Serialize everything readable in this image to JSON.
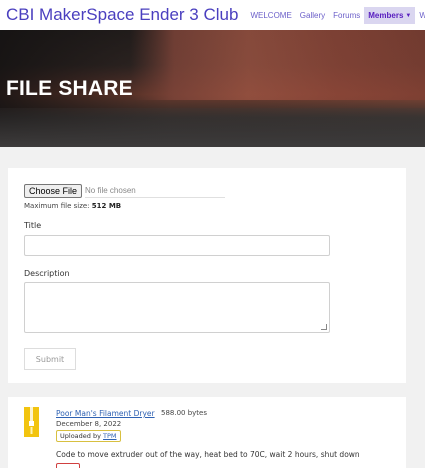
{
  "header": {
    "site_title": "CBI MakerSpace Ender 3 Club",
    "nav": [
      {
        "label": "WELCOME"
      },
      {
        "label": "Gallery"
      },
      {
        "label": "Forums"
      },
      {
        "label": "Members"
      },
      {
        "label": "Workflow"
      }
    ]
  },
  "hero": {
    "title": "FILE SHARE"
  },
  "upload": {
    "choose_file_label": "Choose File",
    "no_file_text": "No file chosen",
    "max_size_prefix": "Maximum file size:",
    "max_size_value": "512 MB",
    "title_label": "Title",
    "title_value": "",
    "description_label": "Description",
    "description_value": "",
    "submit_label": "Submit"
  },
  "files": [
    {
      "name": "Poor Man's Filament Dryer",
      "size": "588.00 bytes",
      "date": "December 8, 2022",
      "uploaded_by_prefix": "Uploaded by",
      "uploader": "TPM",
      "description": "Code to move extruder out of the way, heat bed to 70C, wait 2 hours, shut down"
    }
  ],
  "colors": {
    "accent": "#4a3fbf",
    "active_nav_bg": "#dad6f0",
    "file_icon": "#f2c40f"
  }
}
